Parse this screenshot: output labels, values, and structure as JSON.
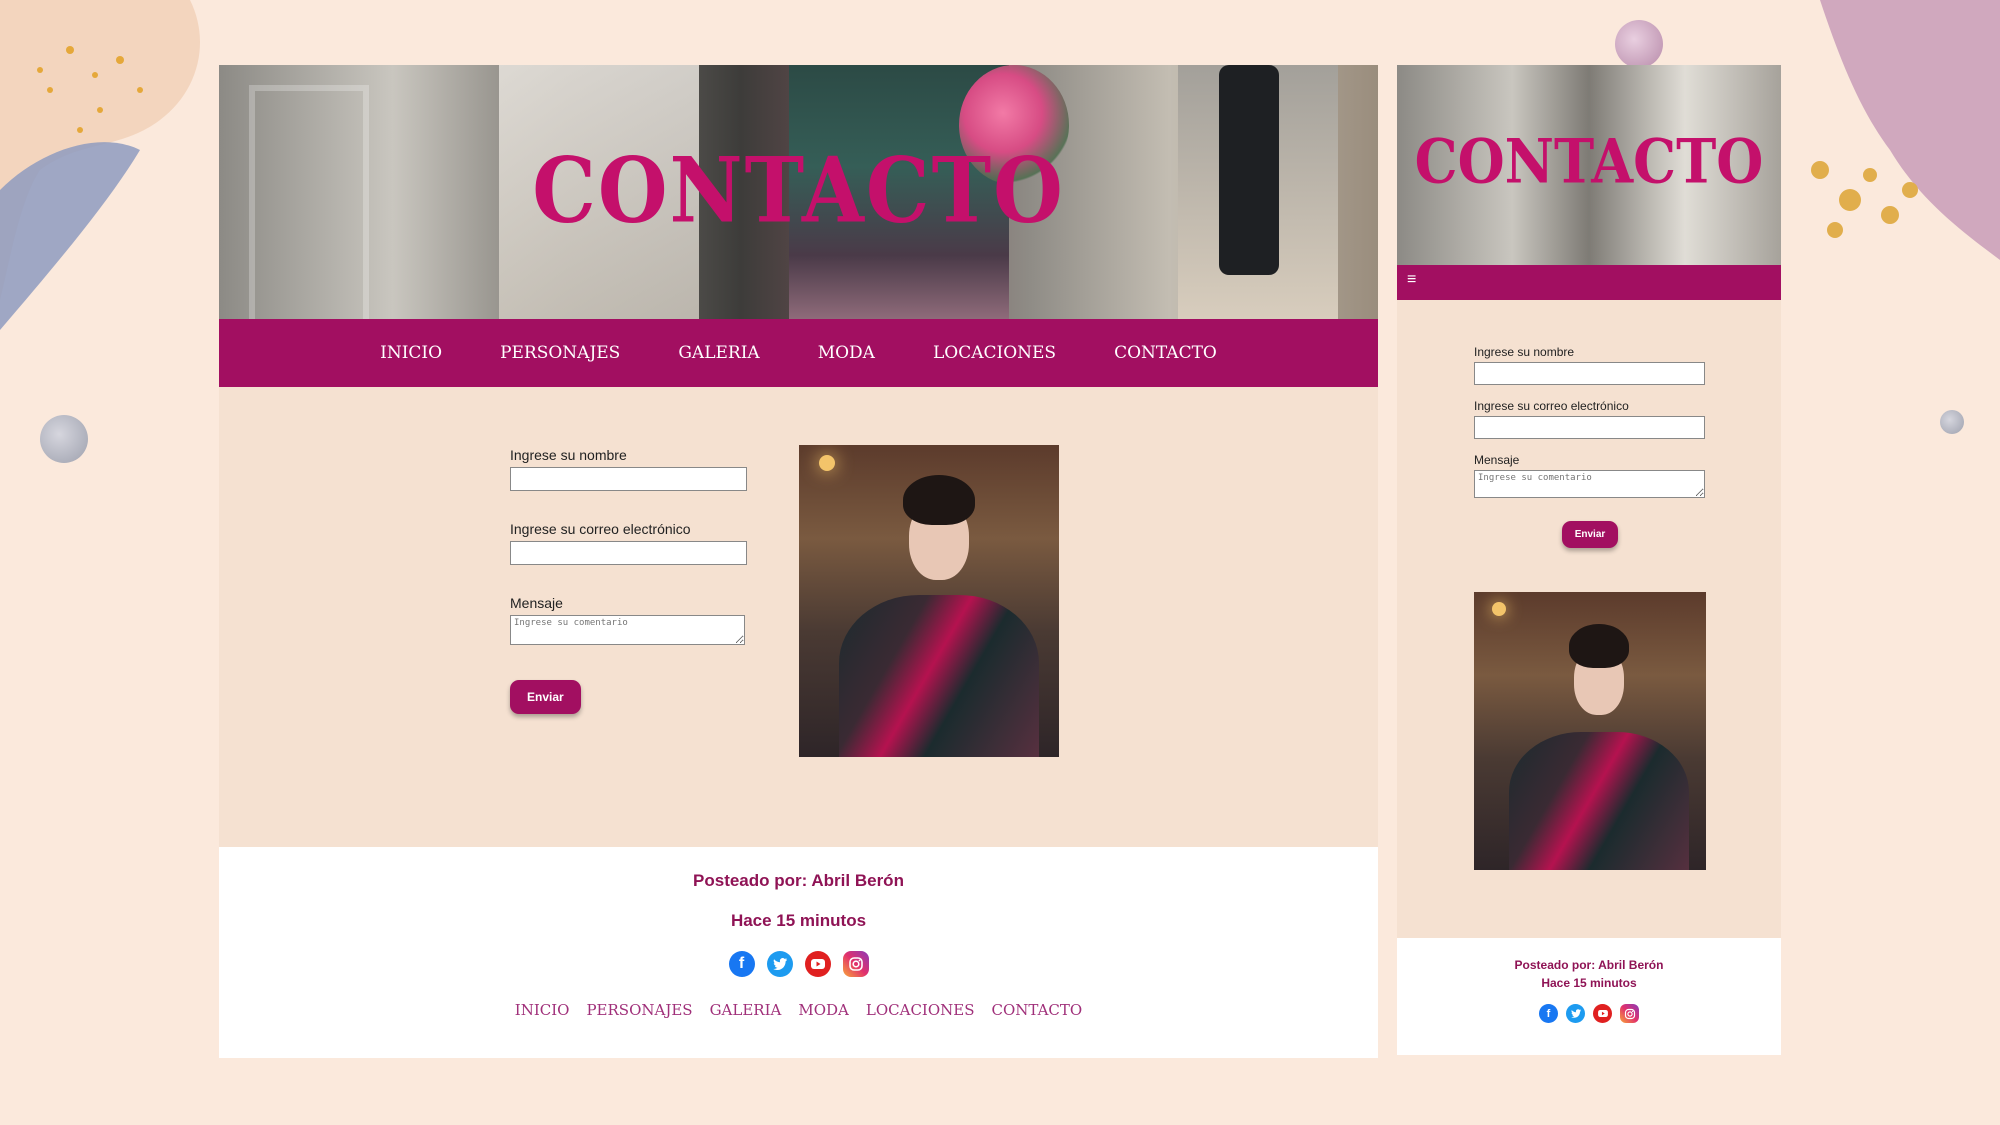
{
  "page": {
    "title": "CONTACTO"
  },
  "nav": [
    "INICIO",
    "PERSONAJES",
    "GALERIA",
    "MODA",
    "LOCACIONES",
    "CONTACTO"
  ],
  "form": {
    "name_label": "Ingrese su nombre",
    "email_label": "Ingrese su correo electrónico",
    "message_label": "Mensaje",
    "message_placeholder": "Ingrese su comentario",
    "submit_label": "Enviar"
  },
  "footer": {
    "posted_by": "Posteado por: Abril Berón",
    "time": "Hace 15 minutos",
    "social": [
      "facebook-icon",
      "twitter-icon",
      "youtube-icon",
      "instagram-icon"
    ]
  },
  "mobile": {
    "menu_icon": "≡"
  },
  "colors": {
    "accent": "#a20f61",
    "title": "#c4106b",
    "background": "#f5e1d1"
  }
}
